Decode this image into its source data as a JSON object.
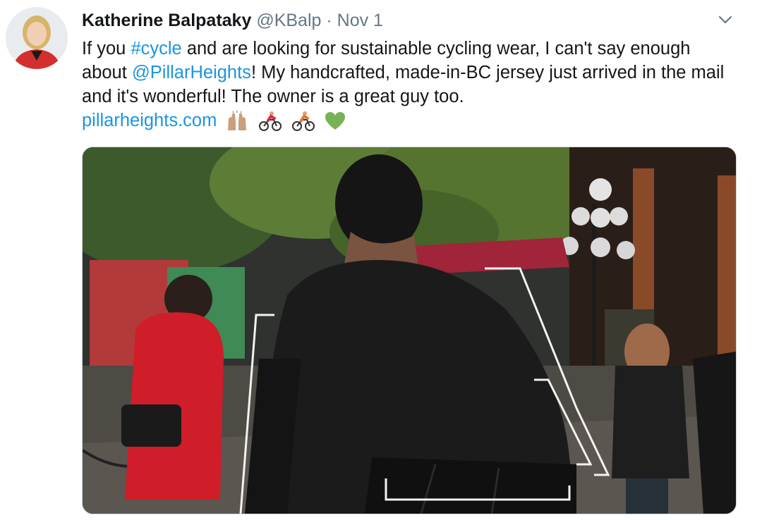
{
  "tweet": {
    "author_name": "Katherine Balpataky",
    "handle": "@KBalp",
    "separator": "·",
    "timestamp": "Nov 1",
    "text_part1": "If you ",
    "hashtag": "#cycle",
    "text_part2": " and are looking for sustainable cycling wear, I can't say enough about ",
    "mention": "@PillarHeights",
    "text_part3": "! My handcrafted, made-in-BC jersey just arrived in the mail and it's wonderful! The owner is a great guy too.",
    "url": "pillarheights.com",
    "emojis": [
      "raised-hands-icon",
      "cyclist-icon",
      "cyclist-icon",
      "green-heart-icon"
    ]
  },
  "colors": {
    "link": "#1b95e0",
    "secondary_text": "#657786",
    "primary_text": "#14171a"
  },
  "icons": {
    "menu": "chevron-down-icon"
  }
}
